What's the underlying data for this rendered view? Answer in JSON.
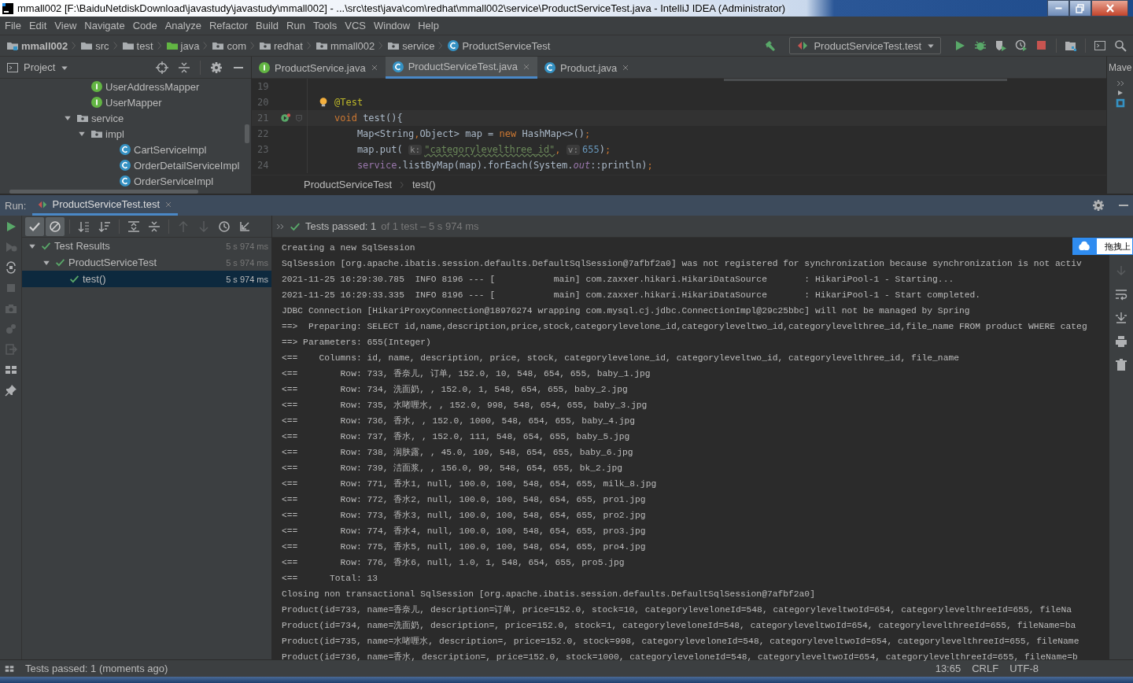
{
  "window": {
    "title": "mmall002 [F:\\BaiduNetdiskDownload\\javastudy\\javastudy\\mmall002] - ...\\src\\test\\java\\com\\redhat\\mmall002\\service\\ProductServiceTest.java - IntelliJ IDEA (Administrator)"
  },
  "menu": [
    "File",
    "Edit",
    "View",
    "Navigate",
    "Code",
    "Analyze",
    "Refactor",
    "Build",
    "Run",
    "Tools",
    "VCS",
    "Window",
    "Help"
  ],
  "navbar": {
    "crumbs": [
      {
        "label": "mmall002",
        "kind": "module"
      },
      {
        "label": "src",
        "kind": "folder"
      },
      {
        "label": "test",
        "kind": "folder"
      },
      {
        "label": "java",
        "kind": "test-root"
      },
      {
        "label": "com",
        "kind": "package"
      },
      {
        "label": "redhat",
        "kind": "package"
      },
      {
        "label": "mmall002",
        "kind": "package"
      },
      {
        "label": "service",
        "kind": "package"
      },
      {
        "label": "ProductServiceTest",
        "kind": "class"
      }
    ],
    "run_config": "ProductServiceTest.test"
  },
  "project_panel": {
    "title": "Project",
    "tree": [
      {
        "name": "UserAddressMapper",
        "kind": "interface"
      },
      {
        "name": "UserMapper",
        "kind": "interface"
      },
      {
        "name": "service",
        "kind": "package",
        "expanded": true,
        "children": [
          {
            "name": "impl",
            "kind": "package",
            "expanded": true,
            "children": [
              {
                "name": "CartServiceImpl",
                "kind": "class"
              },
              {
                "name": "OrderDetailServiceImpl",
                "kind": "class"
              },
              {
                "name": "OrderServiceImpl",
                "kind": "class"
              }
            ]
          }
        ]
      }
    ]
  },
  "editor": {
    "tabs": [
      {
        "label": "ProductService.java",
        "kind": "interface",
        "selected": false
      },
      {
        "label": "ProductServiceTest.java",
        "kind": "class",
        "selected": true
      },
      {
        "label": "Product.java",
        "kind": "class",
        "selected": false
      }
    ],
    "lines": [
      {
        "number": "19"
      },
      {
        "number": "20",
        "bulb": true,
        "tokens": [
          {
            "text": "@Test",
            "kind": "annotation"
          }
        ]
      },
      {
        "number": "21",
        "run_marker": true,
        "current": true,
        "tokens": [
          {
            "text": "void ",
            "kind": "keyword"
          },
          {
            "text": "test",
            "kind": "plain"
          },
          {
            "text": "(){",
            "kind": "plain"
          }
        ]
      },
      {
        "number": "22",
        "tokens": [
          {
            "text": "    Map<String",
            "kind": "plain"
          },
          {
            "text": ",",
            "kind": "keyword"
          },
          {
            "text": "Object> map = ",
            "kind": "plain"
          },
          {
            "text": "new",
            "kind": "keyword"
          },
          {
            "text": " HashMap<>()",
            "kind": "plain"
          },
          {
            "text": ";",
            "kind": "keyword"
          }
        ]
      },
      {
        "number": "23",
        "tokens": [
          {
            "text": "    map.put( ",
            "kind": "plain"
          },
          {
            "text": "k:",
            "kind": "hint"
          },
          {
            "text": "\"categorylevelthree_id\"",
            "kind": "string"
          },
          {
            "text": ", ",
            "kind": "keyword"
          },
          {
            "text": "v:",
            "kind": "hint"
          },
          {
            "text": "655",
            "kind": "number"
          },
          {
            "text": ")",
            "kind": "plain"
          },
          {
            "text": ";",
            "kind": "keyword"
          }
        ]
      },
      {
        "number": "24",
        "tokens": [
          {
            "text": "    service",
            "kind": "member"
          },
          {
            "text": ".listByMap(map).forEach(System.",
            "kind": "plain"
          },
          {
            "text": "out",
            "kind": "field"
          },
          {
            "text": "::println)",
            "kind": "plain"
          },
          {
            "text": ";",
            "kind": "keyword"
          }
        ]
      }
    ],
    "breadcrumb": [
      "ProductServiceTest",
      "test()"
    ]
  },
  "right_toolbar": {
    "label": "Mave"
  },
  "run_panel": {
    "label": "Run:",
    "tabs": [
      {
        "label": "ProductServiceTest.test",
        "selected": true
      }
    ],
    "filters": {
      "show_passed": true,
      "show_ignored": true
    },
    "summary": {
      "passed": "Tests passed: 1",
      "detail": "of 1 test – 5 s 974 ms"
    },
    "tests": [
      {
        "name": "Test Results",
        "time": "5 s 974 ms",
        "passed": true,
        "expanded": true,
        "selected": false,
        "children": [
          {
            "name": "ProductServiceTest",
            "time": "5 s 974 ms",
            "passed": true,
            "expanded": true,
            "selected": false,
            "children": [
              {
                "name": "test()",
                "time": "5 s 974 ms",
                "passed": true,
                "selected": true
              }
            ]
          }
        ]
      }
    ],
    "console": [
      "Creating a new SqlSession",
      "SqlSession [org.apache.ibatis.session.defaults.DefaultSqlSession@7afbf2a0] was not registered for synchronization because synchronization is not activ",
      "2021-11-25 16:29:30.785  INFO 8196 --- [           main] com.zaxxer.hikari.HikariDataSource       : HikariPool-1 - Starting...",
      "2021-11-25 16:29:33.335  INFO 8196 --- [           main] com.zaxxer.hikari.HikariDataSource       : HikariPool-1 - Start completed.",
      "JDBC Connection [HikariProxyConnection@18976274 wrapping com.mysql.cj.jdbc.ConnectionImpl@29c25bbc] will not be managed by Spring",
      "==>  Preparing: SELECT id,name,description,price,stock,categorylevelone_id,categoryleveltwo_id,categorylevelthree_id,file_name FROM product WHERE categ",
      "==> Parameters: 655(Integer)",
      "<==    Columns: id, name, description, price, stock, categorylevelone_id, categoryleveltwo_id, categorylevelthree_id, file_name",
      "<==        Row: 733, 香奈儿, 订单, 152.0, 10, 548, 654, 655, baby_1.jpg",
      "<==        Row: 734, 洗面奶, , 152.0, 1, 548, 654, 655, baby_2.jpg",
      "<==        Row: 735, 水啫喱水, , 152.0, 998, 548, 654, 655, baby_3.jpg",
      "<==        Row: 736, 香水, , 152.0, 1000, 548, 654, 655, baby_4.jpg",
      "<==        Row: 737, 香水, , 152.0, 111, 548, 654, 655, baby_5.jpg",
      "<==        Row: 738, 润肤露, , 45.0, 109, 548, 654, 655, baby_6.jpg",
      "<==        Row: 739, 洁面浆, , 156.0, 99, 548, 654, 655, bk_2.jpg",
      "<==        Row: 771, 香水1, null, 100.0, 100, 548, 654, 655, milk_8.jpg",
      "<==        Row: 772, 香水2, null, 100.0, 100, 548, 654, 655, pro1.jpg",
      "<==        Row: 773, 香水3, null, 100.0, 100, 548, 654, 655, pro2.jpg",
      "<==        Row: 774, 香水4, null, 100.0, 100, 548, 654, 655, pro3.jpg",
      "<==        Row: 775, 香水5, null, 100.0, 100, 548, 654, 655, pro4.jpg",
      "<==        Row: 776, 香水6, null, 1.0, 1, 548, 654, 655, pro5.jpg",
      "<==      Total: 13",
      "Closing non transactional SqlSession [org.apache.ibatis.session.defaults.DefaultSqlSession@7afbf2a0]",
      "Product(id=733, name=香奈儿, description=订单, price=152.0, stock=10, categoryleveloneId=548, categoryleveltwoId=654, categorylevelthreeId=655, fileNa",
      "Product(id=734, name=洗面奶, description=, price=152.0, stock=1, categoryleveloneId=548, categoryleveltwoId=654, categorylevelthreeId=655, fileName=ba",
      "Product(id=735, name=水啫喱水, description=, price=152.0, stock=998, categoryleveloneId=548, categoryleveltwoId=654, categorylevelthreeId=655, fileName",
      "Product(id=736, name=香水, description=, price=152.0, stock=1000, categoryleveloneId=548, categoryleveltwoId=654, categorylevelthreeId=655, fileName=b"
    ],
    "upload_widget": {
      "label": "拖拽上"
    }
  },
  "status_bar": {
    "message": "Tests passed: 1 (moments ago)",
    "position": "13:65",
    "line_separator": "CRLF",
    "encoding": "UTF-8"
  }
}
